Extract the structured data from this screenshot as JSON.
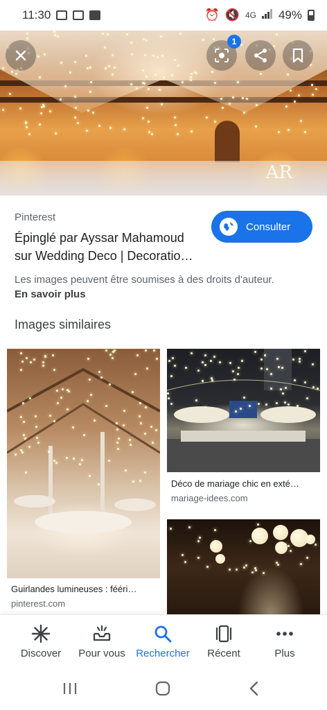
{
  "status_bar": {
    "time": "11:30",
    "network": "4G",
    "battery": "49%"
  },
  "hero": {
    "watermark": "AR",
    "lens_badge": "1"
  },
  "result": {
    "source": "Pinterest",
    "title_line1": "Épinglé par Ayssar Mahamoud",
    "title_line2": "sur Wedding Deco | Decoratio…",
    "consult_label": "Consulter",
    "copyright": "Les images peuvent être soumises à des droits d'auteur.",
    "learn_more": "En savoir plus"
  },
  "similar": {
    "heading": "Images similaires",
    "items": [
      {
        "caption": "Guirlandes lumineuses : fééri…",
        "domain": "pinterest.com"
      },
      {
        "caption": "Déco de mariage chic en exté…",
        "domain": "mariage-idees.com"
      }
    ]
  },
  "bottom_nav": [
    {
      "label": "Discover",
      "icon": "asterisk-icon",
      "active": false
    },
    {
      "label": "Pour vous",
      "icon": "inbox-sparkle-icon",
      "active": false
    },
    {
      "label": "Rechercher",
      "icon": "search-icon",
      "active": true
    },
    {
      "label": "Récent",
      "icon": "tabs-icon",
      "active": false
    },
    {
      "label": "Plus",
      "icon": "more-dots-icon",
      "active": false
    }
  ],
  "colors": {
    "accent": "#1a73e8",
    "text": "#202124",
    "secondary": "#5f6368"
  }
}
